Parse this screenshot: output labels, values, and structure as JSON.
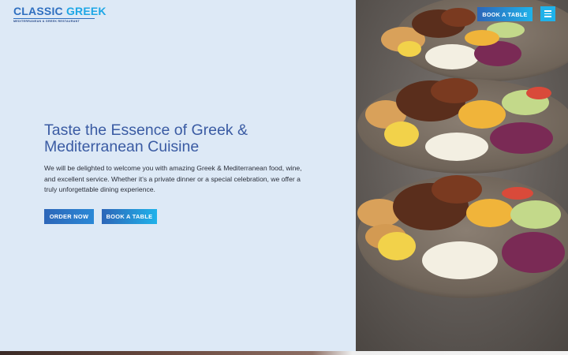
{
  "brand": {
    "name_part1": "CLASSIC",
    "name_part2": "GREEK",
    "tagline": "MEDITERRANEAN & GREEK RESTAURANT"
  },
  "header": {
    "book_label": "BOOK A TABLE",
    "menu_icon": "hamburger-icon"
  },
  "hero": {
    "heading": "Taste the Essence of Greek & Mediterranean Cuisine",
    "text": "We will be delighted to welcome you with amazing Greek & Mediterranean food, wine, and excellent service. Whether it's a private dinner or a special celebration, we offer a truly unforgettable dining experience.",
    "order_label": "ORDER NOW",
    "book_label": "BOOK A TABLE"
  },
  "colors": {
    "background": "#dde9f6",
    "heading": "#3a5ba3",
    "brand_blue": "#2f6fc0",
    "accent_cyan": "#1fb2ea"
  }
}
